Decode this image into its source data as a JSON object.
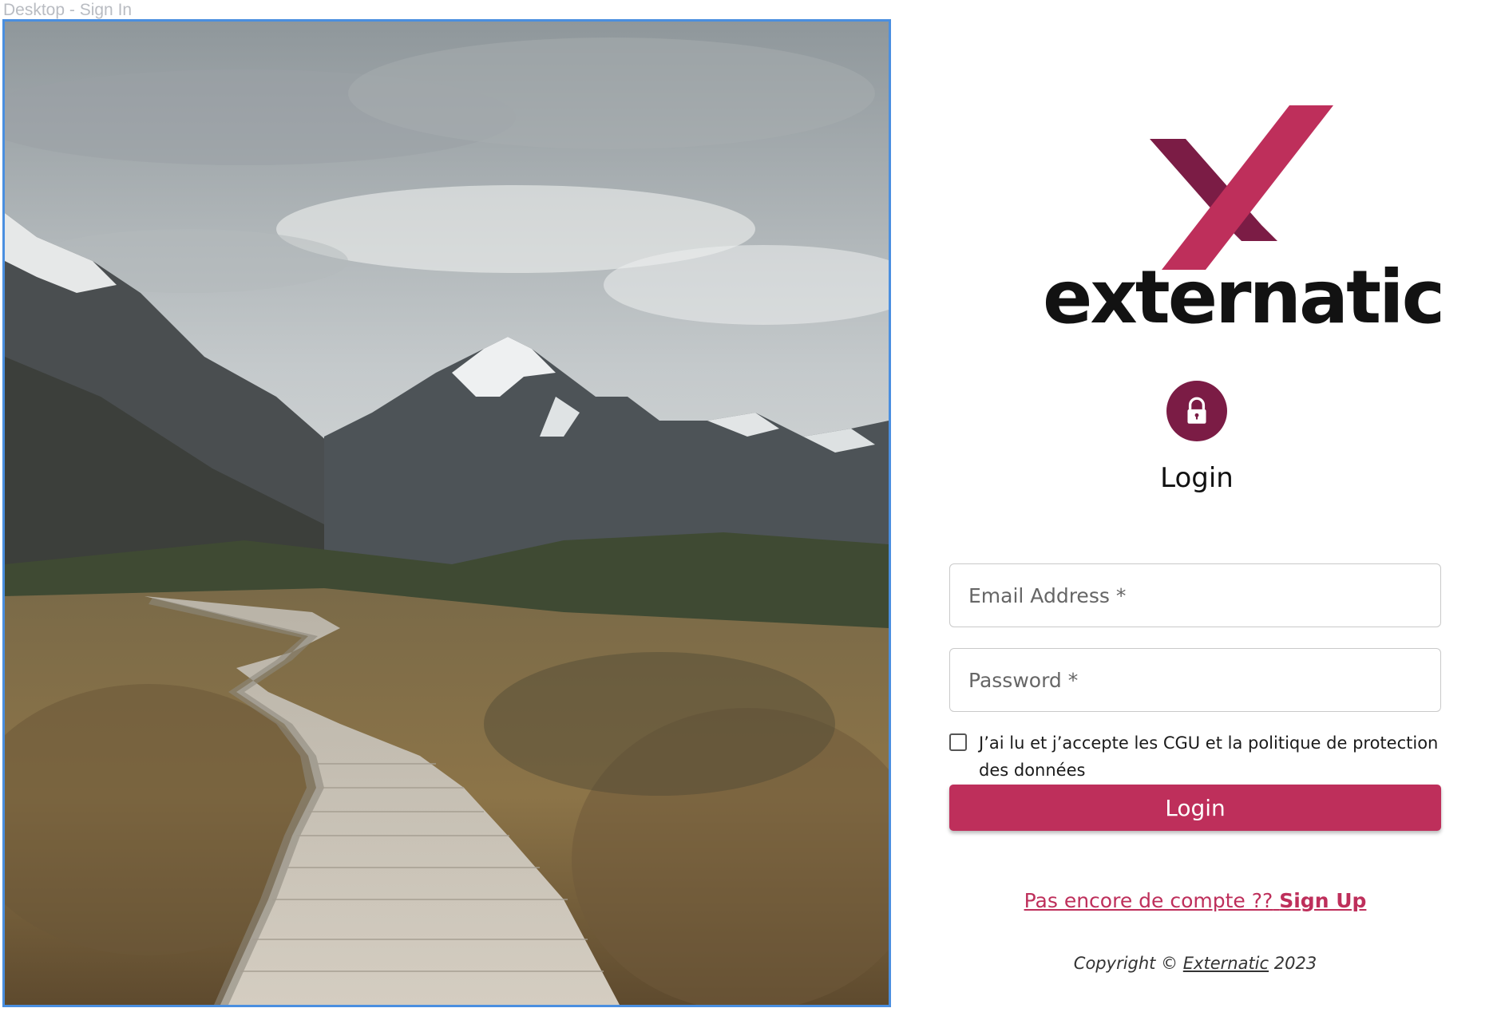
{
  "frame": {
    "title": "Desktop - Sign In"
  },
  "brand": {
    "name": "externatic",
    "colors": {
      "primary": "#be2f5b",
      "dark": "#7b1c45"
    }
  },
  "form": {
    "title": "Login",
    "email_placeholder": "Email Address *",
    "password_placeholder": "Password *",
    "consent_label": "J’ai lu et j’accepte les CGU et la politique de protection des données",
    "consent_checked": false,
    "login_button": "Login"
  },
  "signup": {
    "prompt": "Pas encore de compte ??",
    "link_label": "Sign Up"
  },
  "footer": {
    "prefix": "Copyright ©",
    "company": "Externatic",
    "year": "2023"
  },
  "icons": {
    "lock": "lock-icon",
    "checkbox": "checkbox-unchecked"
  }
}
